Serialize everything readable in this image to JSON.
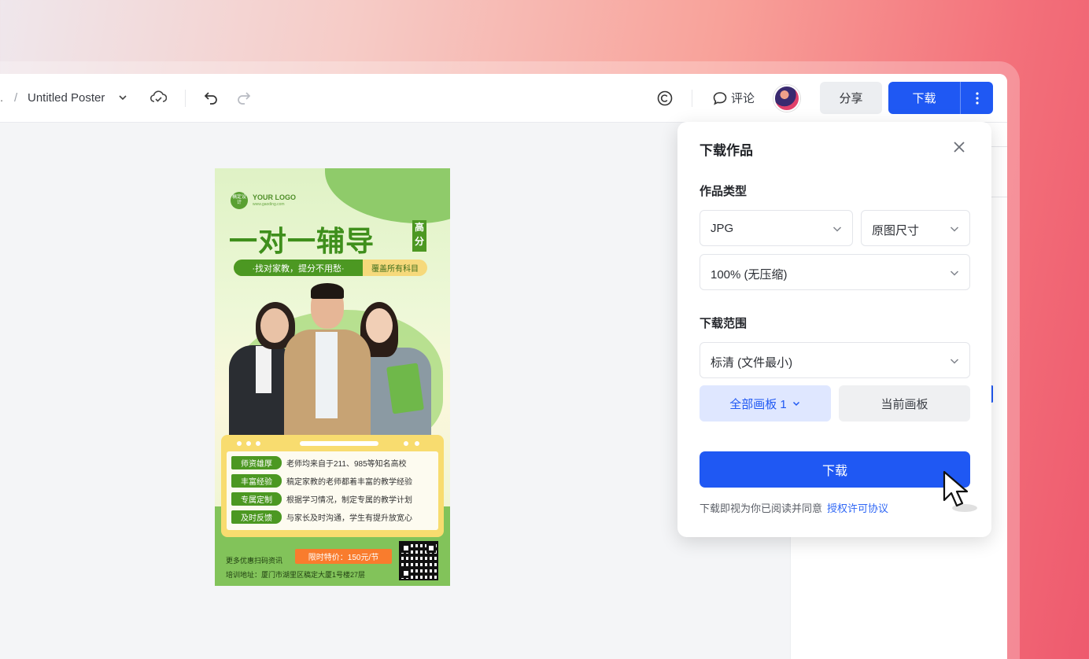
{
  "toolbar": {
    "crumb_prefix": ".",
    "crumb_sep": "/",
    "doc_title": "Untitled Poster",
    "comment_label": "评论",
    "share_label": "分享",
    "download_label": "下载"
  },
  "poster": {
    "logo_badge": "稿定设计",
    "logo_text": "YOUR LOGO",
    "logo_sub": "www.gaoding.com",
    "headline": "一对一辅导",
    "headline_tag": "高分",
    "slogan": "·找对家教，提分不用愁·",
    "slogan_tag": "覆盖所有科目",
    "features": [
      {
        "key": "师资雄厚",
        "value": "老师均来自于211、985等知名高校"
      },
      {
        "key": "丰富经验",
        "value": "稿定家教的老师都着丰富的教学经验"
      },
      {
        "key": "专属定制",
        "value": "根据学习情况，制定专属的教学计划"
      },
      {
        "key": "及时反馈",
        "value": "与家长及时沟通，学生有提升放宽心"
      }
    ],
    "promo_line": "更多优惠扫码资讯",
    "price_tag": "限时特价：150元/节",
    "address": "培训地址：厦门市湖里区稿定大厦1号楼27层"
  },
  "dialog": {
    "title": "下载作品",
    "type_label": "作品类型",
    "format": "JPG",
    "size": "原图尺寸",
    "quality": "100% (无压缩)",
    "range_label": "下载范围",
    "resolution": "标清 (文件最小)",
    "all_boards": "全部画板 1",
    "current_board": "当前画板",
    "download_button": "下载",
    "agreement_text": "下载即视为你已阅读并同意",
    "agreement_link": "授权许可协议"
  },
  "colors": {
    "primary": "#1f58f3",
    "poster_green": "#4c9822",
    "poster_yellow": "#f8dc6f",
    "price_orange": "#f97c2d"
  }
}
